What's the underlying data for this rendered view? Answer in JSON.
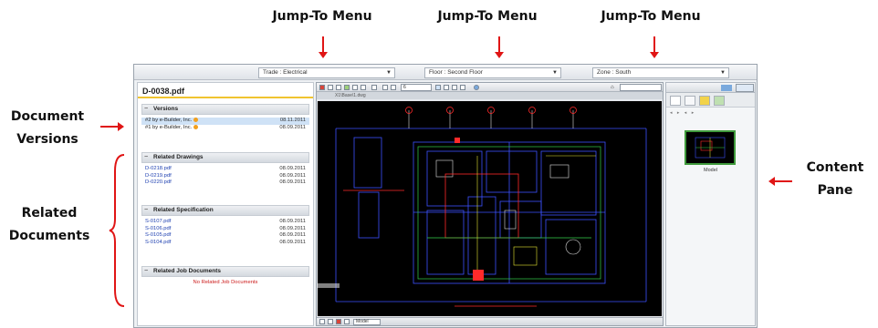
{
  "annotations": {
    "jump_menu_1": "Jump-To Menu",
    "jump_menu_2": "Jump-To Menu",
    "jump_menu_3": "Jump-To Menu",
    "document_versions": [
      "Document",
      "Versions"
    ],
    "related_documents": [
      "Related",
      "Documents"
    ],
    "content_pane": [
      "Content",
      "Pane"
    ]
  },
  "jump_bar": {
    "trade": "Trade :  Electrical",
    "floor": "Floor : Second Floor",
    "zone": "Zone : South"
  },
  "document": {
    "title": "D-0038.pdf",
    "versions": {
      "heading": "Versions",
      "items": [
        {
          "label": "#2 by e-Builder, Inc.",
          "date": "08.11.2011",
          "selected": true
        },
        {
          "label": "#1 by e-Builder, Inc.",
          "date": "08.09.2011",
          "selected": false
        }
      ]
    },
    "related_drawings": {
      "heading": "Related Drawings",
      "items": [
        {
          "label": "D-0218.pdf",
          "date": "08.09.2011"
        },
        {
          "label": "D-0219.pdf",
          "date": "08.09.2011"
        },
        {
          "label": "D-0220.pdf",
          "date": "08.09.2011"
        }
      ]
    },
    "related_specification": {
      "heading": "Related Specification",
      "items": [
        {
          "label": "S-0107.pdf",
          "date": "08.09.2011"
        },
        {
          "label": "S-0106.pdf",
          "date": "08.09.2011"
        },
        {
          "label": "S-0105.pdf",
          "date": "08.09.2011"
        },
        {
          "label": "S-0104.pdf",
          "date": "08.09.2011"
        }
      ]
    },
    "related_job_documents": {
      "heading": "Related Job Documents",
      "empty_text": "No Related Job Documents"
    }
  },
  "viewer": {
    "zoom": "6",
    "path": "X1\\Base\\1.dwg",
    "layout": "Model"
  },
  "content_pane": {
    "thumbnail_label": "Model"
  },
  "colors": {
    "arrow": "#e01515",
    "title_underline": "#f0c430",
    "link": "#1d3fb0",
    "selected_row": "#cfe2f6",
    "cad_background": "#000000"
  }
}
